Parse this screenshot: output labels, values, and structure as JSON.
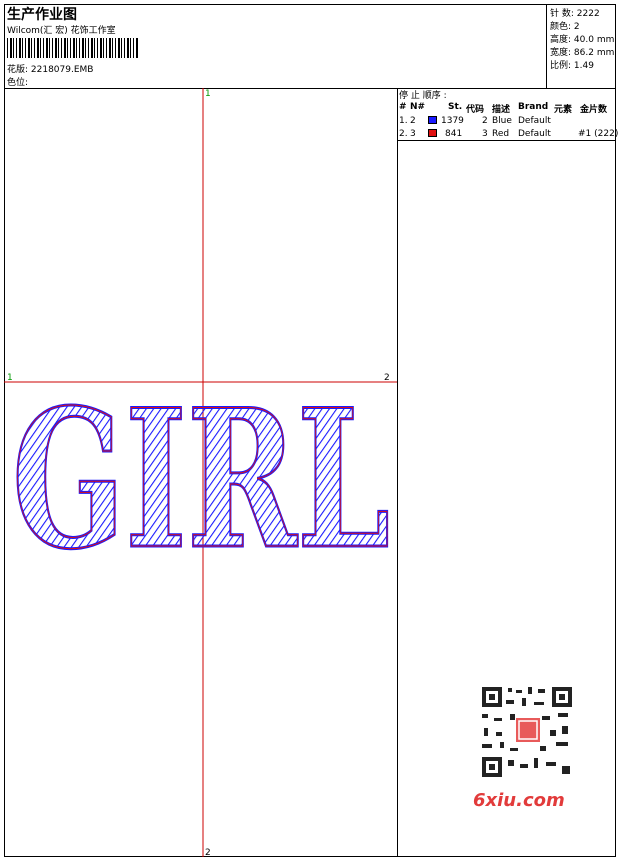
{
  "header": {
    "title": "生产作业图",
    "company": "Wilcom(汇 宏) 花饰工作室",
    "design_label": "花版: 2218079.EMB",
    "color_label": "色位:"
  },
  "stats": [
    {
      "label": "针 数:",
      "value": "2222"
    },
    {
      "label": "颜色:",
      "value": "2"
    },
    {
      "label": "高度:",
      "value": "40.0 mm"
    },
    {
      "label": "宽度:",
      "value": "86.2 mm"
    },
    {
      "label": "比例:",
      "value": "1.49"
    }
  ],
  "stop_sequence": {
    "title": "停 止 顺序 :",
    "headers": [
      "#",
      "N#",
      "St.",
      "代码",
      "描述",
      "Brand",
      "元素",
      "金片数"
    ],
    "rows": [
      {
        "num": "1.",
        "n": "2",
        "color": "#1a1aff",
        "st": "1379",
        "code": "2",
        "desc": "Blue",
        "brand": "Default",
        "element": "",
        "sequins": ""
      },
      {
        "num": "2.",
        "n": "3",
        "color": "#e01010",
        "st": "841",
        "code": "3",
        "desc": "Red",
        "brand": "Default",
        "element": "#1 (222)",
        "sequins": ""
      }
    ]
  },
  "canvas": {
    "axis_labels": [
      "1",
      "2",
      "1",
      "2"
    ],
    "design_text": "GIRL",
    "site": "6xiu.com",
    "colors": {
      "blue": "#1a1aff",
      "red": "#e01010",
      "axis": "#cc0000"
    }
  }
}
